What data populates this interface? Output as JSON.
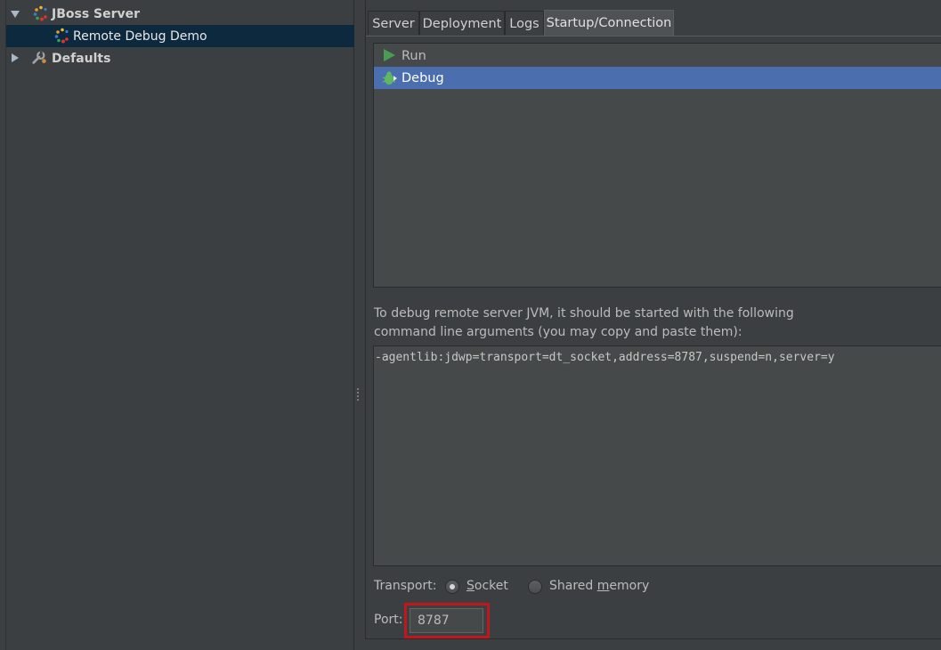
{
  "tree": {
    "items": [
      {
        "label": "JBoss Server",
        "expanded": true,
        "icon": "jboss-icon"
      },
      {
        "label": "Remote Debug Demo",
        "selected": true,
        "icon": "jboss-icon"
      },
      {
        "label": "Defaults",
        "expanded": false,
        "icon": "wrench-icon"
      }
    ]
  },
  "tabs": [
    {
      "label": "Server"
    },
    {
      "label": "Deployment"
    },
    {
      "label": "Logs"
    },
    {
      "label": "Startup/Connection",
      "active": true
    }
  ],
  "modes": [
    {
      "label": "Run",
      "icon": "run-icon"
    },
    {
      "label": "Debug",
      "icon": "debug-icon",
      "selected": true
    }
  ],
  "hint": {
    "line1": "To debug remote server JVM, it should be started with the following",
    "line2": "command line arguments (you may copy and paste them):"
  },
  "args": "-agentlib:jdwp=transport=dt_socket,address=8787,suspend=n,server=y",
  "transport": {
    "label": "Transport:",
    "options": [
      {
        "prefix": "",
        "mnemonic": "S",
        "rest": "ocket",
        "selected": true
      },
      {
        "prefix": "Shared ",
        "mnemonic": "m",
        "rest": "emory",
        "selected": false
      }
    ]
  },
  "port": {
    "label": "Port:",
    "value": "8787"
  },
  "colors": {
    "background": "#3c3f41",
    "selection": "#4b6eaf",
    "tree_selection": "#0d293e",
    "highlight": "#c0161c",
    "run_green": "#499c54"
  }
}
